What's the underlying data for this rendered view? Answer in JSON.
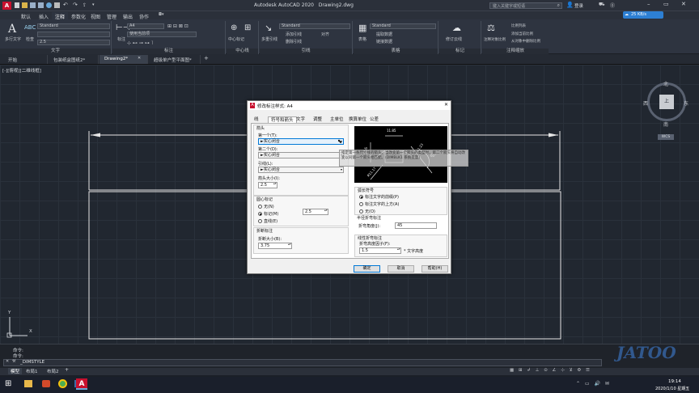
{
  "app": {
    "title": "Autodesk AutoCAD 2020",
    "document": "Drawing2.dwg",
    "search_placeholder": "键入关键字或短语",
    "login": "登录",
    "network_speed": "25 KB/s"
  },
  "menu": [
    "默认",
    "插入",
    "注释",
    "参数化",
    "视图",
    "管理",
    "输出",
    "协作"
  ],
  "menu_active_index": 2,
  "ribbon": {
    "panels": [
      {
        "label": "文字"
      },
      {
        "label": "标注"
      },
      {
        "label": "中心线"
      },
      {
        "label": "引线"
      },
      {
        "label": "表格"
      },
      {
        "label": "标记"
      },
      {
        "label": "注释缩放"
      }
    ],
    "text_style": "Standard",
    "text_height": "2.5",
    "dim_style": "A4",
    "dim_layer": "使用当前项",
    "leader_style": "Standard",
    "table_style": "Standard",
    "multiline_text": "多行文字",
    "check_spelling": "检查",
    "dimension": "标注",
    "centerline": "中心标记",
    "leader": "多重引线",
    "add_leader": "添加引线",
    "remove_leader": "删除引线",
    "align": "对齐",
    "table": "表格",
    "extract": "提取数据",
    "link": "链接数据",
    "revcloud": "修订云线",
    "scale_list": "比例列表",
    "add_scale": "添加当前比例",
    "remove_scale": "从对象中删除比例",
    "annot_scale": "注释对象比例"
  },
  "doc_tabs": [
    {
      "label": "开始",
      "active": false
    },
    {
      "label": "包装纸盒图纸2*",
      "active": false
    },
    {
      "label": "Drawing2*",
      "active": true
    },
    {
      "label": "超级单户型平面图*",
      "active": false
    }
  ],
  "viewport": {
    "view_label": "[-][俯视][二维线框]",
    "compass": {
      "north": "北",
      "south": "南",
      "east": "东",
      "west": "西",
      "top": "上"
    },
    "wcs": "WCS",
    "axis_x": "X",
    "axis_y": "Y"
  },
  "dialog": {
    "title": "修改标注样式: A4",
    "tabs": [
      "线",
      "符号和箭头",
      "文字",
      "调整",
      "主单位",
      "换算单位",
      "公差"
    ],
    "active_tab_index": 1,
    "arrows_group": "箭头",
    "first_label": "第一个(T):",
    "first_value": "实心闭合",
    "second_label": "第二个(D):",
    "second_value": "实心闭合",
    "leader_label": "引线(L):",
    "leader_value": "实心闭合",
    "arrow_size_label": "箭头大小(I):",
    "arrow_size_value": "2.5",
    "center_group": "圆心标记",
    "center_none": "无(N)",
    "center_mark": "标记(M)",
    "center_line": "直线(E)",
    "center_size": "2.5",
    "break_group": "折断标注",
    "break_size_label": "折断大小(B):",
    "break_size_value": "3.75",
    "arc_group": "弧长符号",
    "arc_front": "标注文字的前缀(P)",
    "arc_above": "标注文字的上方(A)",
    "arc_none": "无(O)",
    "jog_radius_group": "半径折弯标注",
    "jog_angle_label": "折弯角度(J):",
    "jog_angle_value": "45",
    "jog_linear_group": "线性折弯标注",
    "jog_factor_label": "折弯高度因子(F):",
    "jog_factor_value": "1.5",
    "jog_factor_unit": "* 文字高度",
    "tooltip": "指定第一条尺寸线的箭头。当改变第一个箭头的类型时，第二个箭头将自动改变以同第一个箭头相匹配。(DIMBLK1 系统变量)",
    "preview_values": [
      "11.85",
      "16.6",
      "21.23",
      "R11.17",
      "60°"
    ],
    "ok": "确定",
    "cancel": "取消",
    "help": "帮助(H)"
  },
  "command": {
    "line1": "命令:",
    "line2": "命令:",
    "input": "_DIMSTYLE"
  },
  "layout_tabs": [
    "模型",
    "布局1",
    "布局2"
  ],
  "taskbar": {
    "time": "19:14",
    "date": "2020/1/10 星期五"
  },
  "watermark": "JATOO",
  "colors": {
    "accent": "#0078d7",
    "autocad_red": "#c8102e",
    "viewport_bg": "#212730"
  }
}
